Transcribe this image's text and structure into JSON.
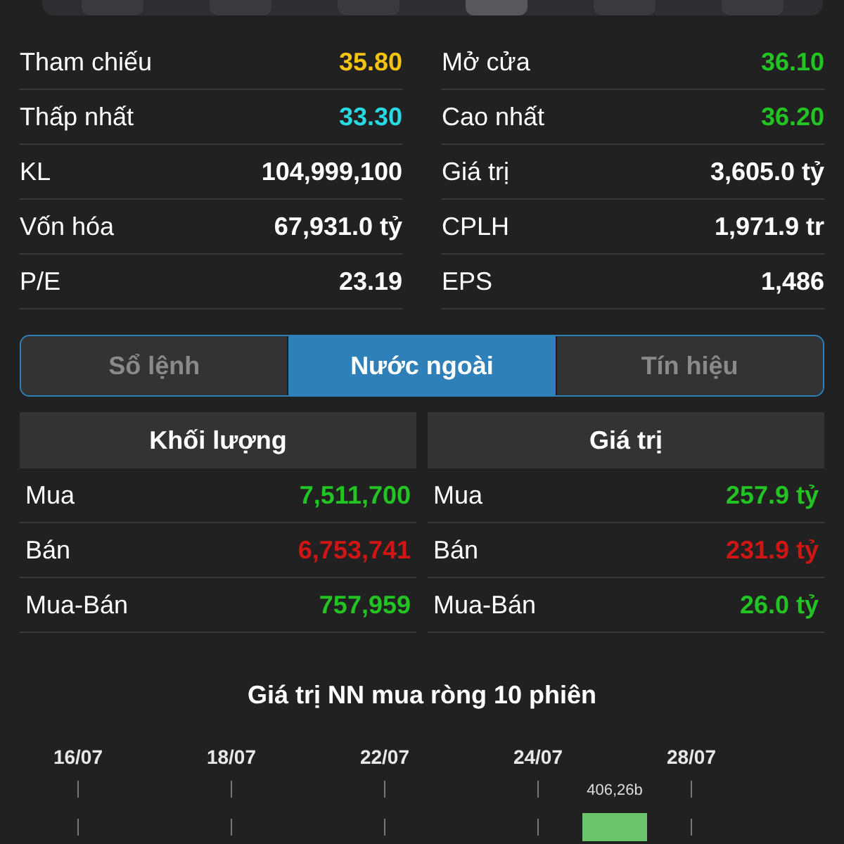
{
  "top_segment": {
    "segments": [
      {
        "selected": false
      },
      {
        "selected": false
      },
      {
        "selected": false
      },
      {
        "selected": true
      },
      {
        "selected": false
      },
      {
        "selected": false
      }
    ]
  },
  "stats": {
    "left": [
      {
        "label": "Tham chiếu",
        "value": "35.80",
        "color": "#f2c311"
      },
      {
        "label": "Thấp nhất",
        "value": "33.30",
        "color": "#27d9e3"
      },
      {
        "label": "KL",
        "value": "104,999,100",
        "color": "#ffffff"
      },
      {
        "label": "Vốn hóa",
        "value": "67,931.0 tỷ",
        "color": "#ffffff"
      },
      {
        "label": "P/E",
        "value": "23.19",
        "color": "#ffffff"
      }
    ],
    "right": [
      {
        "label": "Mở cửa",
        "value": "36.10",
        "color": "#22c322"
      },
      {
        "label": "Cao nhất",
        "value": "36.20",
        "color": "#22c322"
      },
      {
        "label": "Giá trị",
        "value": "3,605.0 tỷ",
        "color": "#ffffff"
      },
      {
        "label": "CPLH",
        "value": "1,971.9 tr",
        "color": "#ffffff"
      },
      {
        "label": "EPS",
        "value": "1,486",
        "color": "#ffffff"
      }
    ]
  },
  "tabs": [
    {
      "label": "Sổ lệnh",
      "selected": false
    },
    {
      "label": "Nước ngoài",
      "selected": true
    },
    {
      "label": "Tín hiệu",
      "selected": false
    }
  ],
  "foreign": [
    {
      "header": "Khối lượng",
      "rows": [
        {
          "label": "Mua",
          "value": "7,511,700",
          "color": "#22c322"
        },
        {
          "label": "Bán",
          "value": "6,753,741",
          "color": "#d01515"
        },
        {
          "label": "Mua-Bán",
          "value": "757,959",
          "color": "#22c322"
        }
      ]
    },
    {
      "header": "Giá trị",
      "rows": [
        {
          "label": "Mua",
          "value": "257.9 tỷ",
          "color": "#22c322"
        },
        {
          "label": "Bán",
          "value": "231.9 tỷ",
          "color": "#d01515"
        },
        {
          "label": "Mua-Bán",
          "value": "26.0 tỷ",
          "color": "#22c322"
        }
      ]
    }
  ],
  "net_buy_chart": {
    "title": "Giá trị NN mua ròng 10 phiên",
    "date_labels": [
      "16/07",
      "18/07",
      "22/07",
      "24/07",
      "28/07"
    ],
    "bar_label": "406,26b"
  }
}
